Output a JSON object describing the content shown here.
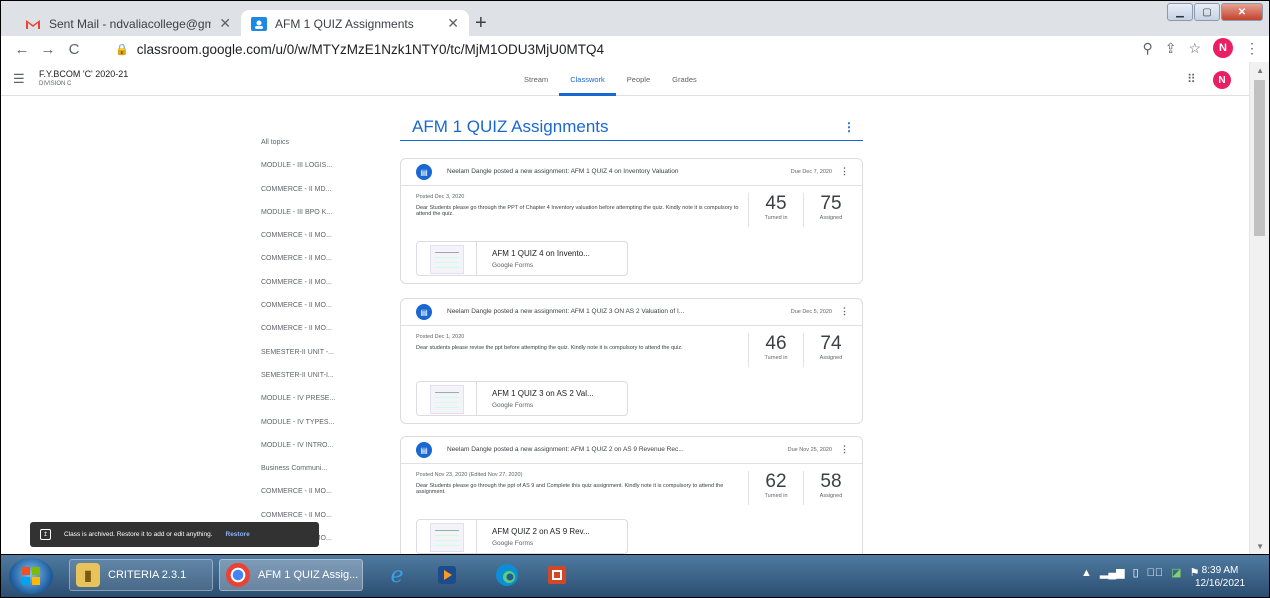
{
  "browser": {
    "tabs": [
      {
        "title": "Sent Mail - ndvaliacollege@gma",
        "favicon": "gmail-icon"
      },
      {
        "title": "AFM 1 QUIZ Assignments",
        "favicon": "classroom-icon"
      }
    ],
    "url": "classroom.google.com/u/0/w/MTYzMzE1Nzk1NTY0/tc/MjM1ODU3MjU0MTQ4",
    "avatar_letter": "N"
  },
  "classroom": {
    "class_name": "F.Y.BCOM 'C' 2020-21",
    "class_section": "DIVISION C",
    "tabs": [
      "Stream",
      "Classwork",
      "People",
      "Grades"
    ],
    "active_tab": "Classwork",
    "avatar_letter": "N"
  },
  "topics": [
    "All topics",
    "MODULE - III LOGIS...",
    "COMMERCE - II MD...",
    "MODULE - III BPO K...",
    "COMMERCE - II MO...",
    "COMMERCE - II MO...",
    "COMMERCE - II MO...",
    "COMMERCE - II MO...",
    "COMMERCE - II MO...",
    "SEMESTER-II UNIT -...",
    "SEMESTER-II UNIT-I...",
    "MODULE - IV PRESE...",
    "MODULE - IV TYPES...",
    "MODULE - IV INTRO...",
    "Business Communi...",
    "COMMERCE - II MO...",
    "COMMERCE - II MO...",
    "COMMERCE - II MO..."
  ],
  "main": {
    "title": "AFM 1 QUIZ Assignments",
    "cards": [
      {
        "heading": "Neelam Dangle posted a new assignment: AFM 1 QUIZ 4 on Inventory Valuation",
        "due": "Due Dec 7, 2020",
        "posted": "Posted Dec 3, 2020",
        "description": "Dear Students please go through the PPT of Chapter 4 Inventory valuation before attempting the quiz. Kindly note it is compulsory to attend the quiz.",
        "turned_in": "45",
        "turned_in_label": "Turned in",
        "assigned": "75",
        "assigned_label": "Assigned",
        "attachment_title": "AFM 1 QUIZ 4 on Invento...",
        "attachment_type": "Google Forms"
      },
      {
        "heading": "Neelam Dangle posted a new assignment: AFM 1 QUIZ 3 ON AS 2 Valuation of I...",
        "due": "Due Dec 5, 2020",
        "posted": "Posted Dec 1, 2020",
        "description": "Dear students please revise the ppt before attempting the quiz. Kindly note it is compulsory to attend the quiz.",
        "turned_in": "46",
        "turned_in_label": "Turned in",
        "assigned": "74",
        "assigned_label": "Assigned",
        "attachment_title": "AFM 1 QUIZ 3 on AS 2 Val...",
        "attachment_type": "Google Forms"
      },
      {
        "heading": "Neelam Dangle posted a new assignment: AFM 1 QUIZ 2 on AS 9 Revenue Rec...",
        "due": "Due Nov 25, 2020",
        "posted": "Posted Nov 23, 2020 (Edited Nov 27, 2020)",
        "description": "Dear Students please go through the ppt of AS 9 and Complete this quiz assignment. Kindly note it is compulsory to attend the assignment.",
        "turned_in": "62",
        "turned_in_label": "Turned in",
        "assigned": "58",
        "assigned_label": "Assigned",
        "attachment_title": "AFM QUIZ 2 on AS 9 Rev...",
        "attachment_type": "Google Forms"
      }
    ]
  },
  "snackbar": {
    "text": "Class is archived. Restore it to add or edit anything.",
    "action": "Restore"
  },
  "taskbar": {
    "tasks": [
      {
        "label": "CRITERIA 2.3.1",
        "icon": "folder-icon"
      },
      {
        "label": "AFM 1 QUIZ Assig...",
        "icon": "chrome-icon"
      }
    ],
    "pinned": [
      "internet-explorer-icon",
      "media-player-icon",
      "edge-icon",
      "presentation-icon"
    ],
    "time": "8:39 AM",
    "date": "12/16/2021"
  }
}
